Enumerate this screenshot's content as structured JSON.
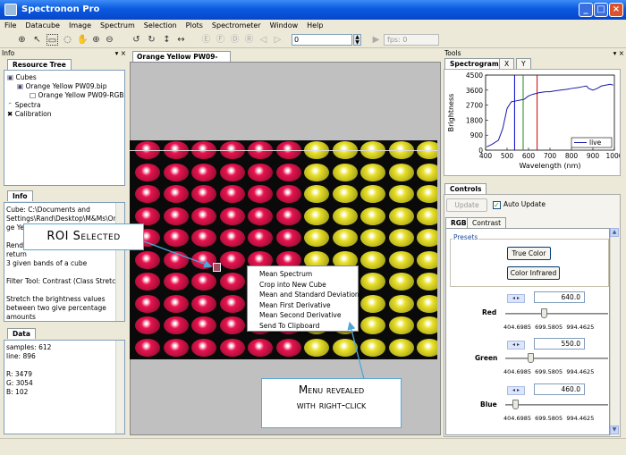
{
  "window": {
    "title": "Spectronon Pro",
    "min": "_",
    "max": "□",
    "close": "×"
  },
  "menu": [
    "File",
    "Datacube",
    "Image",
    "Spectrum",
    "Selection",
    "Plots",
    "Spectrometer",
    "Window",
    "Help"
  ],
  "toolbar": {
    "frame_value": "0",
    "fps": "fps: 0"
  },
  "info_panel": {
    "title": "Info",
    "resource_tab": "Resource Tree",
    "tree": {
      "cubes": "Cubes",
      "cube1": "Orange Yellow PW09.bip",
      "cube2": "Orange Yellow PW09-RGB",
      "spectra": "Spectra",
      "calibration": "Calibration"
    },
    "info_tab": "Info",
    "info_lines": [
      "Cube: C:\\Documents and",
      "Settings\\Rand\\Desktop\\M&Ms\\Oran",
      "ge Yel",
      "",
      "Rende",
      "return",
      "3 given bands of a cube",
      "",
      "Filter Tool: Contrast (Class Stretch)",
      "",
      "    Stretch the brightness values",
      "between two give percentage",
      "amounts"
    ],
    "data_tab": "Data",
    "data_lines": [
      "samples: 612",
      "line: 896",
      "",
      "R: 3479",
      "G: 3054",
      "B: 102"
    ]
  },
  "document": {
    "tab": "Orange Yellow PW09-RGB"
  },
  "context_menu": [
    "Mean Spectrum",
    "Crop into New Cube",
    "Mean and Standard Deviation",
    "Mean First Derivative",
    "Mean Second Derivative",
    "Send To Clipboard"
  ],
  "callouts": {
    "roi": "ROI Selected",
    "menu_line1": "Menu revealed",
    "menu_line2": "with right-click"
  },
  "tools_panel": {
    "title": "Tools",
    "tabs": [
      "Spectrogram",
      "X",
      "Y"
    ],
    "legend": "live",
    "xlabel": "Wavelength (nm)",
    "ylabel": "Brightness"
  },
  "chart_data": {
    "type": "line",
    "xlabel": "Wavelength (nm)",
    "ylabel": "Brightness",
    "xlim": [
      400,
      1000
    ],
    "ylim": [
      0,
      4500
    ],
    "xticks": [
      "400",
      "500",
      "600",
      "700",
      "800",
      "900",
      "1000"
    ],
    "yticks": [
      "0",
      "900",
      "1800",
      "2700",
      "3600",
      "4500"
    ],
    "series": [
      {
        "name": "live",
        "x": [
          405,
          430,
          460,
          480,
          500,
          520,
          540,
          560,
          580,
          600,
          620,
          650,
          680,
          700,
          720,
          750,
          780,
          800,
          830,
          850,
          870,
          880,
          900,
          920,
          940,
          960,
          980,
          995
        ],
        "y": [
          200,
          350,
          600,
          1300,
          2500,
          2900,
          2950,
          3000,
          3050,
          3250,
          3350,
          3450,
          3500,
          3500,
          3550,
          3600,
          3650,
          3700,
          3750,
          3800,
          3850,
          3700,
          3600,
          3700,
          3850,
          3900,
          3950,
          3900
        ]
      }
    ],
    "markers": [
      {
        "x": 535,
        "color": "#0000cc"
      },
      {
        "x": 575,
        "color": "#1a8a1a"
      },
      {
        "x": 640,
        "color": "#cc0000"
      }
    ],
    "legend_position": "bottom-right"
  },
  "controls": {
    "title": "Controls",
    "update": "Update",
    "auto_update": "Auto Update",
    "tabs": [
      "RGB",
      "Contrast"
    ],
    "presets": "Presets",
    "true_color": "True Color",
    "color_infrared": "Color Infrared",
    "red": {
      "label": "Red",
      "value": "640.0",
      "min": "404.6985",
      "mid": "699.5805",
      "max": "994.4625",
      "level": 0.36
    },
    "green": {
      "label": "Green",
      "value": "550.0",
      "min": "404.6985",
      "mid": "699.5805",
      "max": "994.4625",
      "level": 0.23
    },
    "blue": {
      "label": "Blue",
      "value": "460.0",
      "min": "404.6985",
      "mid": "699.5805",
      "max": "994.4625",
      "level": 0.07
    }
  },
  "colors": {
    "red": "#e8134f",
    "yellow": "#e8e02a",
    "titlebar": "#0a5ae0"
  }
}
